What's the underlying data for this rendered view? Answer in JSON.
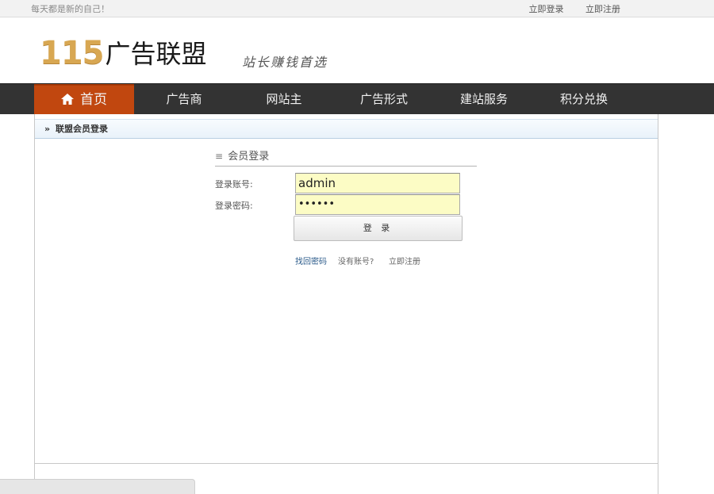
{
  "topbar": {
    "slogan": "每天都是新的自己！",
    "login_link": "立即登录",
    "register_link": "立即注册"
  },
  "header": {
    "logo_number": "115",
    "logo_name": "广告联盟",
    "tagline": "站长赚钱首选"
  },
  "nav": {
    "items": [
      {
        "label": "首页",
        "icon": "home-icon",
        "active": true
      },
      {
        "label": "广告商"
      },
      {
        "label": "网站主"
      },
      {
        "label": "广告形式"
      },
      {
        "label": "建站服务"
      },
      {
        "label": "积分兑换"
      }
    ]
  },
  "breadcrumb": {
    "arrow": "»",
    "label": "联盟会员登录"
  },
  "login": {
    "title_icon": "≡",
    "title": "会员登录",
    "account_label": "登录账号:",
    "account_value": "admin",
    "password_label": "登录密码:",
    "password_value": "••••••",
    "submit_label": "登 录",
    "forgot_link": "找回密码",
    "no_account_text": "没有账号?",
    "register_link": "立即注册"
  },
  "colors": {
    "nav_bg": "#333333",
    "nav_active": "#c1470f",
    "input_bg": "#fcfcc5",
    "logo_gold": "#d8a752"
  }
}
